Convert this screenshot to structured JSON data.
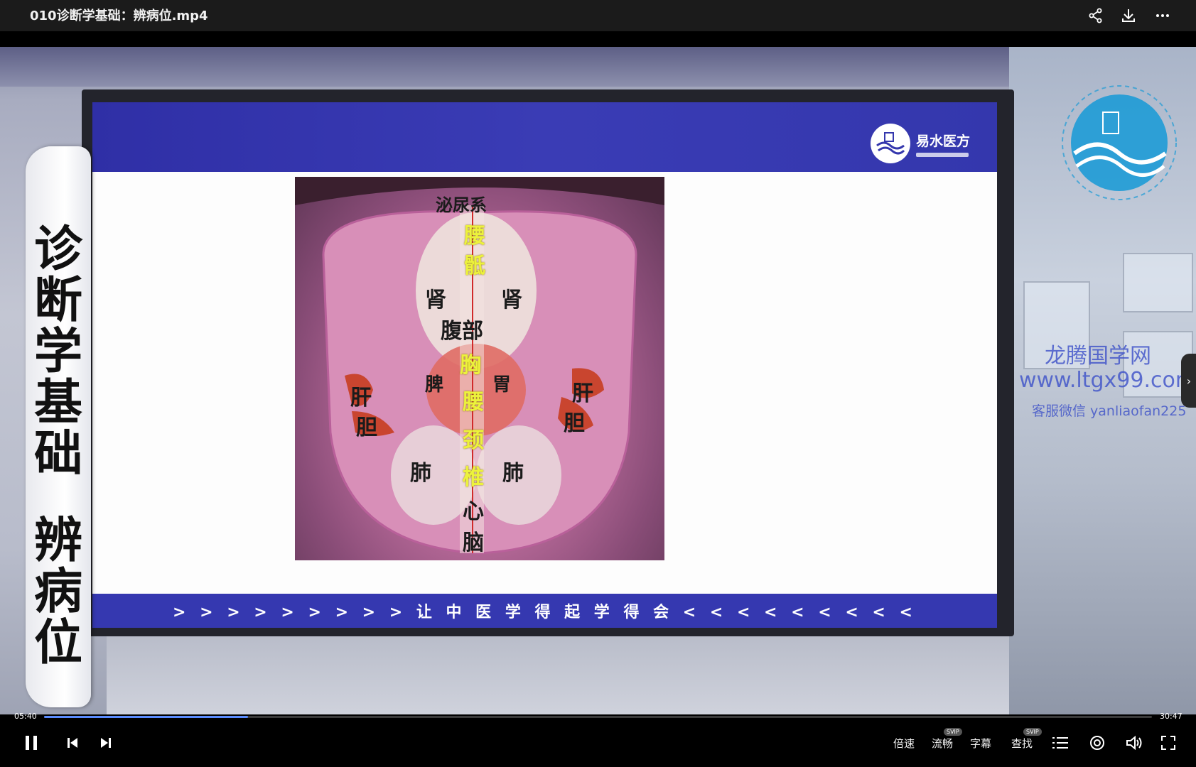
{
  "window": {
    "title": "010诊断学基础：辨病位.mp4"
  },
  "video": {
    "slide": {
      "brand_name": "易水医方",
      "slogan": "> > > > > > > > > 让 中 医 学 得 起 学 得 会 < < < < < < < < <"
    },
    "tongue_labels": {
      "top": "泌尿系",
      "yao": "腰",
      "di": "骶",
      "shen_left": "肾",
      "shen_right": "肾",
      "fu_bu": "腹部",
      "xiong": "胸",
      "pi": "脾",
      "wei": "胃",
      "gan_left": "肝",
      "dan_left": "胆",
      "gan_right": "肝",
      "dan_right": "胆",
      "yao2": "腰",
      "jing": "颈",
      "zhui": "椎",
      "fei_left": "肺",
      "fei_right": "肺",
      "xin": "心",
      "nao": "脑"
    },
    "side_caption": {
      "line1": "诊断学基础",
      "line2": "辨病位"
    },
    "watermark": {
      "site_name": "龙腾国学网",
      "url": "www.ltgx99.com",
      "contact": "客服微信 yanliaofan225"
    }
  },
  "player": {
    "current_time": "05:40",
    "duration": "30:47",
    "progress": 0.184,
    "controls": {
      "speed": "倍速",
      "quality": "流畅",
      "subtitle": "字幕",
      "search": "查找",
      "badge": "SVIP"
    }
  }
}
